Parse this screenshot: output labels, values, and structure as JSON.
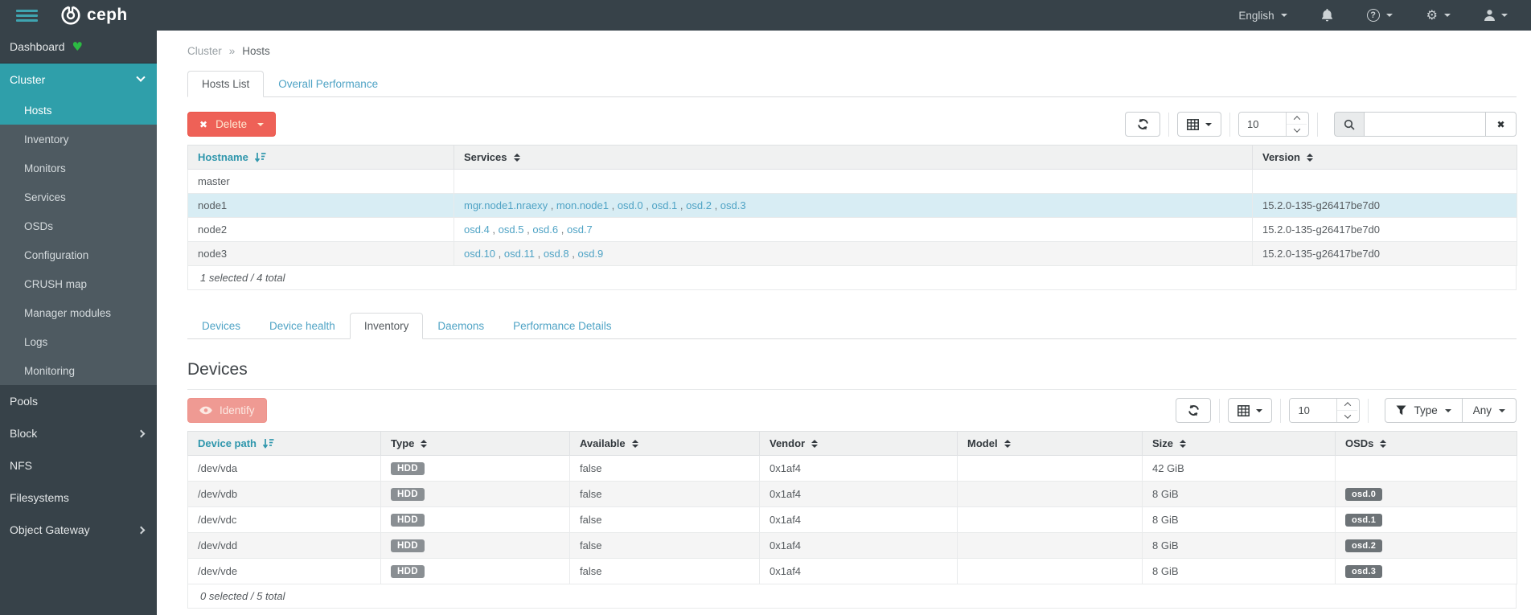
{
  "navbar": {
    "brand": "ceph",
    "language_label": "English"
  },
  "sidebar": {
    "dashboard_label": "Dashboard",
    "cluster_label": "Cluster",
    "cluster_children": [
      "Hosts",
      "Inventory",
      "Monitors",
      "Services",
      "OSDs",
      "Configuration",
      "CRUSH map",
      "Manager modules",
      "Logs",
      "Monitoring"
    ],
    "active_child": "Hosts",
    "pools_label": "Pools",
    "block_label": "Block",
    "nfs_label": "NFS",
    "filesystems_label": "Filesystems",
    "object_gateway_label": "Object Gateway"
  },
  "breadcrumb": {
    "section": "Cluster",
    "separator": "»",
    "page": "Hosts"
  },
  "host_tabs": {
    "hosts_list": "Hosts List",
    "overall_performance": "Overall Performance"
  },
  "hosts_table": {
    "delete_label": "Delete",
    "page_size": "10",
    "search_value": "",
    "headers": {
      "hostname": "Hostname",
      "services": "Services",
      "version": "Version"
    },
    "rows": [
      {
        "hostname": "master",
        "services": [],
        "version": ""
      },
      {
        "hostname": "node1",
        "services": [
          "mgr.node1.nraexy",
          "mon.node1",
          "osd.0",
          "osd.1",
          "osd.2",
          "osd.3"
        ],
        "version": "15.2.0-135-g26417be7d0"
      },
      {
        "hostname": "node2",
        "services": [
          "osd.4",
          "osd.5",
          "osd.6",
          "osd.7"
        ],
        "version": "15.2.0-135-g26417be7d0"
      },
      {
        "hostname": "node3",
        "services": [
          "osd.10",
          "osd.11",
          "osd.8",
          "osd.9"
        ],
        "version": "15.2.0-135-g26417be7d0"
      }
    ],
    "footer": "1 selected / 4 total"
  },
  "detail_tabs": {
    "devices": "Devices",
    "device_health": "Device health",
    "inventory": "Inventory",
    "daemons": "Daemons",
    "performance_details": "Performance Details"
  },
  "devices_section": {
    "heading": "Devices",
    "identify_label": "Identify",
    "page_size": "10",
    "type_filter_label": "Type",
    "type_filter_value": "Any",
    "headers": {
      "path": "Device path",
      "type": "Type",
      "available": "Available",
      "vendor": "Vendor",
      "model": "Model",
      "size": "Size",
      "osds": "OSDs"
    },
    "rows": [
      {
        "path": "/dev/vda",
        "type": "HDD",
        "available": "false",
        "vendor": "0x1af4",
        "model": "",
        "size": "42 GiB",
        "osds": ""
      },
      {
        "path": "/dev/vdb",
        "type": "HDD",
        "available": "false",
        "vendor": "0x1af4",
        "model": "",
        "size": "8 GiB",
        "osds": "osd.0"
      },
      {
        "path": "/dev/vdc",
        "type": "HDD",
        "available": "false",
        "vendor": "0x1af4",
        "model": "",
        "size": "8 GiB",
        "osds": "osd.1"
      },
      {
        "path": "/dev/vdd",
        "type": "HDD",
        "available": "false",
        "vendor": "0x1af4",
        "model": "",
        "size": "8 GiB",
        "osds": "osd.2"
      },
      {
        "path": "/dev/vde",
        "type": "HDD",
        "available": "false",
        "vendor": "0x1af4",
        "model": "",
        "size": "8 GiB",
        "osds": "osd.3"
      }
    ],
    "footer": "0 selected / 5 total"
  },
  "colors": {
    "accent_teal": "#2f9faa",
    "navbar_dark": "#374249",
    "submenu_gray": "#4e5a61",
    "danger_red": "#ee6157",
    "link_blue": "#4fa3c5",
    "selected_row": "#d8edf4",
    "hdd_badge": "#8a8f93",
    "osd_badge": "#6d7377"
  }
}
